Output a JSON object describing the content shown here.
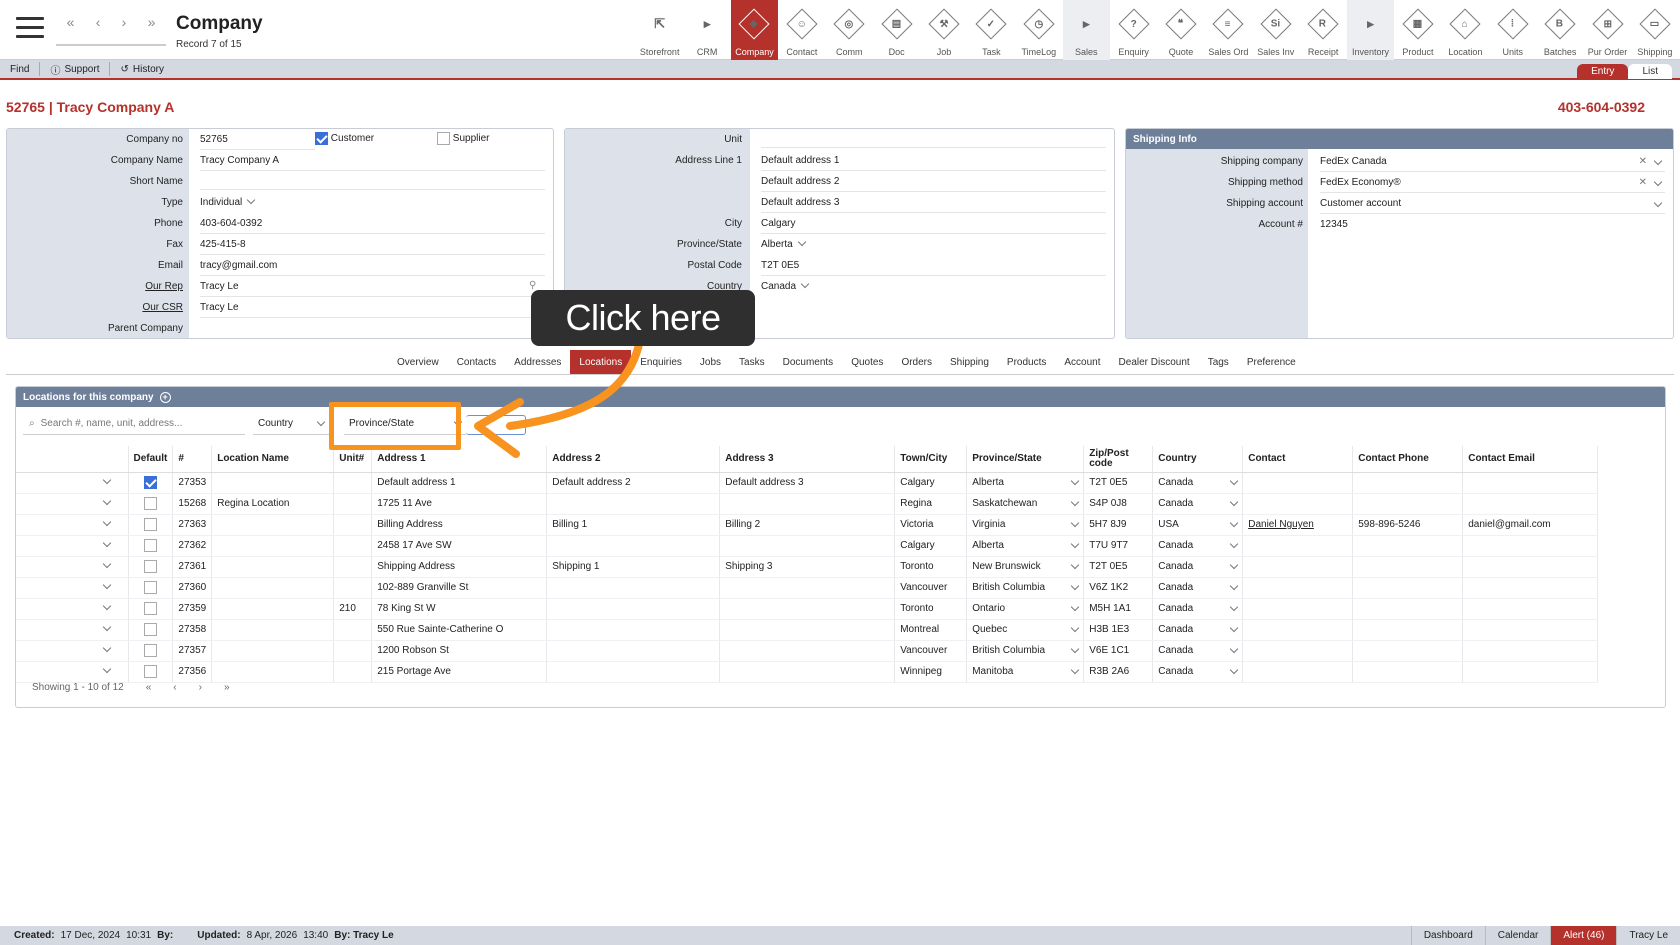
{
  "header": {
    "title": "Company",
    "record": "Record 7 of 15",
    "nav": [
      "«",
      "‹",
      "›",
      "»"
    ]
  },
  "modules": [
    {
      "label": "Storefront",
      "glyph": "⇱",
      "style": "plain"
    },
    {
      "label": "CRM",
      "glyph": "▸",
      "style": "plain"
    },
    {
      "label": "Company",
      "glyph": "◆",
      "style": "active"
    },
    {
      "label": "Contact",
      "glyph": "☺",
      "style": "dia"
    },
    {
      "label": "Comm",
      "glyph": "◎",
      "style": "dia"
    },
    {
      "label": "Doc",
      "glyph": "▤",
      "style": "dia"
    },
    {
      "label": "Job",
      "glyph": "⚒",
      "style": "dia"
    },
    {
      "label": "Task",
      "glyph": "✓",
      "style": "dia"
    },
    {
      "label": "TimeLog",
      "glyph": "◷",
      "style": "dia"
    },
    {
      "label": "Sales",
      "glyph": "▸",
      "style": "gray"
    },
    {
      "label": "Enquiry",
      "glyph": "?",
      "style": "dia"
    },
    {
      "label": "Quote",
      "glyph": "❝",
      "style": "dia"
    },
    {
      "label": "Sales Ord",
      "glyph": "≡",
      "style": "dia"
    },
    {
      "label": "Sales Inv",
      "glyph": "Si",
      "style": "dia"
    },
    {
      "label": "Receipt",
      "glyph": "R",
      "style": "dia"
    },
    {
      "label": "Inventory",
      "glyph": "▸",
      "style": "gray"
    },
    {
      "label": "Product",
      "glyph": "▦",
      "style": "dia"
    },
    {
      "label": "Location",
      "glyph": "⌂",
      "style": "dia"
    },
    {
      "label": "Units",
      "glyph": "⁞",
      "style": "dia"
    },
    {
      "label": "Batches",
      "glyph": "B",
      "style": "dia"
    },
    {
      "label": "Pur Order",
      "glyph": "⊞",
      "style": "dia"
    },
    {
      "label": "Shipping",
      "glyph": "▭",
      "style": "dia"
    }
  ],
  "toolbar": {
    "find": "Find",
    "support": "Support",
    "history": "History"
  },
  "view_toggle": {
    "entry": "Entry",
    "list": "List"
  },
  "record_header": {
    "title": "52765 | Tracy Company A",
    "phone": "403-604-0392"
  },
  "company_form": {
    "company_no_label": "Company no",
    "company_no": "52765",
    "customer_label": "Customer",
    "supplier_label": "Supplier",
    "name_label": "Company Name",
    "name": "Tracy Company A",
    "short_label": "Short Name",
    "short": "",
    "type_label": "Type",
    "type": "Individual",
    "phone_label": "Phone",
    "phone": "403-604-0392",
    "fax_label": "Fax",
    "fax": "425-415-8",
    "email_label": "Email",
    "email": "tracy@gmail.com",
    "rep_label": "Our Rep",
    "rep": "Tracy Le",
    "csr_label": "Our CSR",
    "csr": "Tracy Le",
    "parent_label": "Parent Company",
    "parent": ""
  },
  "address_form": {
    "unit_label": "Unit",
    "unit": "",
    "addr1_label": "Address Line 1",
    "addr1": "Default address 1",
    "addr2": "Default address 2",
    "addr3": "Default address 3",
    "city_label": "City",
    "city": "Calgary",
    "prov_label": "Province/State",
    "prov": "Alberta",
    "postal_label": "Postal Code",
    "postal": "T2T 0E5",
    "country_label": "Country",
    "country": "Canada"
  },
  "shipping_info": {
    "title": "Shipping Info",
    "company_label": "Shipping company",
    "company": "FedEx Canada",
    "method_label": "Shipping method",
    "method": "FedEx Economy®",
    "account_label": "Shipping account",
    "account": "Customer account",
    "acctno_label": "Account #",
    "acctno": "12345"
  },
  "tabs": [
    "Overview",
    "Contacts",
    "Addresses",
    "Locations",
    "Enquiries",
    "Jobs",
    "Tasks",
    "Documents",
    "Quotes",
    "Orders",
    "Shipping",
    "Products",
    "Account",
    "Dealer Discount",
    "Tags",
    "Preference"
  ],
  "active_tab": "Locations",
  "locations": {
    "title": "Locations for this company",
    "search_placeholder": "Search #, name, unit, address...",
    "country_filter": "Country",
    "province_filter": "Province/State",
    "columns": [
      "",
      "Default",
      "#",
      "Location Name",
      "Unit#",
      "Address 1",
      "Address 2",
      "Address 3",
      "Town/City",
      "Province/State",
      "Zip/Post code",
      "Country",
      "Contact",
      "Contact Phone",
      "Contact Email"
    ],
    "rows": [
      {
        "default": true,
        "num": "27353",
        "name": "",
        "unit": "",
        "a1": "Default address 1",
        "a2": "Default address 2",
        "a3": "Default address 3",
        "city": "Calgary",
        "prov": "Alberta",
        "zip": "T2T 0E5",
        "country": "Canada",
        "contact": "",
        "cphone": "",
        "cemail": ""
      },
      {
        "default": false,
        "num": "15268",
        "name": "Regina Location",
        "unit": "",
        "a1": "1725 11 Ave",
        "a2": "",
        "a3": "",
        "city": "Regina",
        "prov": "Saskatchewan",
        "zip": "S4P 0J8",
        "country": "Canada",
        "contact": "",
        "cphone": "",
        "cemail": ""
      },
      {
        "default": false,
        "num": "27363",
        "name": "",
        "unit": "",
        "a1": "Billing Address",
        "a2": "Billing 1",
        "a3": "Billing 2",
        "city": "Victoria",
        "prov": "Virginia",
        "zip": "5H7 8J9",
        "country": "USA",
        "contact": "Daniel Nguyen",
        "cphone": "598-896-5246",
        "cemail": "daniel@gmail.com"
      },
      {
        "default": false,
        "num": "27362",
        "name": "",
        "unit": "",
        "a1": "2458 17 Ave SW",
        "a2": "",
        "a3": "",
        "city": "Calgary",
        "prov": "Alberta",
        "zip": "T7U 9T7",
        "country": "Canada",
        "contact": "",
        "cphone": "",
        "cemail": ""
      },
      {
        "default": false,
        "num": "27361",
        "name": "",
        "unit": "",
        "a1": "Shipping Address",
        "a2": "Shipping 1",
        "a3": "Shipping 3",
        "city": "Toronto",
        "prov": "New Brunswick",
        "zip": "T2T 0E5",
        "country": "Canada",
        "contact": "",
        "cphone": "",
        "cemail": ""
      },
      {
        "default": false,
        "num": "27360",
        "name": "",
        "unit": "",
        "a1": "102-889 Granville St",
        "a2": "",
        "a3": "",
        "city": "Vancouver",
        "prov": "British Columbia",
        "zip": "V6Z 1K2",
        "country": "Canada",
        "contact": "",
        "cphone": "",
        "cemail": ""
      },
      {
        "default": false,
        "num": "27359",
        "name": "",
        "unit": "210",
        "a1": "78 King St W",
        "a2": "",
        "a3": "",
        "city": "Toronto",
        "prov": "Ontario",
        "zip": "M5H 1A1",
        "country": "Canada",
        "contact": "",
        "cphone": "",
        "cemail": ""
      },
      {
        "default": false,
        "num": "27358",
        "name": "",
        "unit": "",
        "a1": "550 Rue Sainte-Catherine O",
        "a2": "",
        "a3": "",
        "city": "Montreal",
        "prov": "Quebec",
        "zip": "H3B 1E3",
        "country": "Canada",
        "contact": "",
        "cphone": "",
        "cemail": ""
      },
      {
        "default": false,
        "num": "27357",
        "name": "",
        "unit": "",
        "a1": "1200 Robson St",
        "a2": "",
        "a3": "",
        "city": "Vancouver",
        "prov": "British Columbia",
        "zip": "V6E 1C1",
        "country": "Canada",
        "contact": "",
        "cphone": "",
        "cemail": ""
      },
      {
        "default": false,
        "num": "27356",
        "name": "",
        "unit": "",
        "a1": "215 Portage Ave",
        "a2": "",
        "a3": "",
        "city": "Winnipeg",
        "prov": "Manitoba",
        "zip": "R3B 2A6",
        "country": "Canada",
        "contact": "",
        "cphone": "",
        "cemail": ""
      }
    ],
    "paging": "Showing 1 - 10 of 12"
  },
  "annotation": {
    "callout": "Click here",
    "color": "#f7931e"
  },
  "footer": {
    "created_label": "Created:",
    "created": "17 Dec, 2024",
    "created_time": "10:31",
    "by_label": "By:",
    "updated_label": "Updated:",
    "updated": "8 Apr, 2026",
    "updated_time": "13:40",
    "updated_by": "By: Tracy Le",
    "dashboard": "Dashboard",
    "calendar": "Calendar",
    "alert": "Alert (46)",
    "user": "Tracy Le"
  },
  "colors": {
    "accent": "#b5312b",
    "panel_header": "#6e7f99",
    "label_bg": "#dde2ea"
  }
}
